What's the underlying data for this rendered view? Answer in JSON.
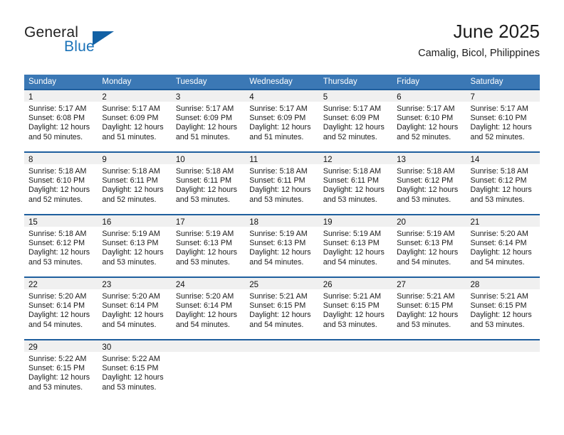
{
  "brand": {
    "name_top": "General",
    "name_bottom": "Blue",
    "triangle_color": "#1261a5",
    "blue_text_color": "#1a72b8"
  },
  "header": {
    "title": "June 2025",
    "subtitle": "Camalig, Bicol, Philippines"
  },
  "theme": {
    "header_bar_color": "#3b78b5",
    "row_border_color": "#1f5f9e",
    "day_band_color": "#f0f0f0"
  },
  "weekdays": [
    "Sunday",
    "Monday",
    "Tuesday",
    "Wednesday",
    "Thursday",
    "Friday",
    "Saturday"
  ],
  "weeks": [
    [
      {
        "day": "1",
        "sunrise": "Sunrise: 5:17 AM",
        "sunset": "Sunset: 6:08 PM",
        "daylight_1": "Daylight: 12 hours",
        "daylight_2": "and 50 minutes."
      },
      {
        "day": "2",
        "sunrise": "Sunrise: 5:17 AM",
        "sunset": "Sunset: 6:09 PM",
        "daylight_1": "Daylight: 12 hours",
        "daylight_2": "and 51 minutes."
      },
      {
        "day": "3",
        "sunrise": "Sunrise: 5:17 AM",
        "sunset": "Sunset: 6:09 PM",
        "daylight_1": "Daylight: 12 hours",
        "daylight_2": "and 51 minutes."
      },
      {
        "day": "4",
        "sunrise": "Sunrise: 5:17 AM",
        "sunset": "Sunset: 6:09 PM",
        "daylight_1": "Daylight: 12 hours",
        "daylight_2": "and 51 minutes."
      },
      {
        "day": "5",
        "sunrise": "Sunrise: 5:17 AM",
        "sunset": "Sunset: 6:09 PM",
        "daylight_1": "Daylight: 12 hours",
        "daylight_2": "and 52 minutes."
      },
      {
        "day": "6",
        "sunrise": "Sunrise: 5:17 AM",
        "sunset": "Sunset: 6:10 PM",
        "daylight_1": "Daylight: 12 hours",
        "daylight_2": "and 52 minutes."
      },
      {
        "day": "7",
        "sunrise": "Sunrise: 5:17 AM",
        "sunset": "Sunset: 6:10 PM",
        "daylight_1": "Daylight: 12 hours",
        "daylight_2": "and 52 minutes."
      }
    ],
    [
      {
        "day": "8",
        "sunrise": "Sunrise: 5:18 AM",
        "sunset": "Sunset: 6:10 PM",
        "daylight_1": "Daylight: 12 hours",
        "daylight_2": "and 52 minutes."
      },
      {
        "day": "9",
        "sunrise": "Sunrise: 5:18 AM",
        "sunset": "Sunset: 6:11 PM",
        "daylight_1": "Daylight: 12 hours",
        "daylight_2": "and 52 minutes."
      },
      {
        "day": "10",
        "sunrise": "Sunrise: 5:18 AM",
        "sunset": "Sunset: 6:11 PM",
        "daylight_1": "Daylight: 12 hours",
        "daylight_2": "and 53 minutes."
      },
      {
        "day": "11",
        "sunrise": "Sunrise: 5:18 AM",
        "sunset": "Sunset: 6:11 PM",
        "daylight_1": "Daylight: 12 hours",
        "daylight_2": "and 53 minutes."
      },
      {
        "day": "12",
        "sunrise": "Sunrise: 5:18 AM",
        "sunset": "Sunset: 6:11 PM",
        "daylight_1": "Daylight: 12 hours",
        "daylight_2": "and 53 minutes."
      },
      {
        "day": "13",
        "sunrise": "Sunrise: 5:18 AM",
        "sunset": "Sunset: 6:12 PM",
        "daylight_1": "Daylight: 12 hours",
        "daylight_2": "and 53 minutes."
      },
      {
        "day": "14",
        "sunrise": "Sunrise: 5:18 AM",
        "sunset": "Sunset: 6:12 PM",
        "daylight_1": "Daylight: 12 hours",
        "daylight_2": "and 53 minutes."
      }
    ],
    [
      {
        "day": "15",
        "sunrise": "Sunrise: 5:18 AM",
        "sunset": "Sunset: 6:12 PM",
        "daylight_1": "Daylight: 12 hours",
        "daylight_2": "and 53 minutes."
      },
      {
        "day": "16",
        "sunrise": "Sunrise: 5:19 AM",
        "sunset": "Sunset: 6:13 PM",
        "daylight_1": "Daylight: 12 hours",
        "daylight_2": "and 53 minutes."
      },
      {
        "day": "17",
        "sunrise": "Sunrise: 5:19 AM",
        "sunset": "Sunset: 6:13 PM",
        "daylight_1": "Daylight: 12 hours",
        "daylight_2": "and 53 minutes."
      },
      {
        "day": "18",
        "sunrise": "Sunrise: 5:19 AM",
        "sunset": "Sunset: 6:13 PM",
        "daylight_1": "Daylight: 12 hours",
        "daylight_2": "and 54 minutes."
      },
      {
        "day": "19",
        "sunrise": "Sunrise: 5:19 AM",
        "sunset": "Sunset: 6:13 PM",
        "daylight_1": "Daylight: 12 hours",
        "daylight_2": "and 54 minutes."
      },
      {
        "day": "20",
        "sunrise": "Sunrise: 5:19 AM",
        "sunset": "Sunset: 6:13 PM",
        "daylight_1": "Daylight: 12 hours",
        "daylight_2": "and 54 minutes."
      },
      {
        "day": "21",
        "sunrise": "Sunrise: 5:20 AM",
        "sunset": "Sunset: 6:14 PM",
        "daylight_1": "Daylight: 12 hours",
        "daylight_2": "and 54 minutes."
      }
    ],
    [
      {
        "day": "22",
        "sunrise": "Sunrise: 5:20 AM",
        "sunset": "Sunset: 6:14 PM",
        "daylight_1": "Daylight: 12 hours",
        "daylight_2": "and 54 minutes."
      },
      {
        "day": "23",
        "sunrise": "Sunrise: 5:20 AM",
        "sunset": "Sunset: 6:14 PM",
        "daylight_1": "Daylight: 12 hours",
        "daylight_2": "and 54 minutes."
      },
      {
        "day": "24",
        "sunrise": "Sunrise: 5:20 AM",
        "sunset": "Sunset: 6:14 PM",
        "daylight_1": "Daylight: 12 hours",
        "daylight_2": "and 54 minutes."
      },
      {
        "day": "25",
        "sunrise": "Sunrise: 5:21 AM",
        "sunset": "Sunset: 6:15 PM",
        "daylight_1": "Daylight: 12 hours",
        "daylight_2": "and 54 minutes."
      },
      {
        "day": "26",
        "sunrise": "Sunrise: 5:21 AM",
        "sunset": "Sunset: 6:15 PM",
        "daylight_1": "Daylight: 12 hours",
        "daylight_2": "and 53 minutes."
      },
      {
        "day": "27",
        "sunrise": "Sunrise: 5:21 AM",
        "sunset": "Sunset: 6:15 PM",
        "daylight_1": "Daylight: 12 hours",
        "daylight_2": "and 53 minutes."
      },
      {
        "day": "28",
        "sunrise": "Sunrise: 5:21 AM",
        "sunset": "Sunset: 6:15 PM",
        "daylight_1": "Daylight: 12 hours",
        "daylight_2": "and 53 minutes."
      }
    ],
    [
      {
        "day": "29",
        "sunrise": "Sunrise: 5:22 AM",
        "sunset": "Sunset: 6:15 PM",
        "daylight_1": "Daylight: 12 hours",
        "daylight_2": "and 53 minutes."
      },
      {
        "day": "30",
        "sunrise": "Sunrise: 5:22 AM",
        "sunset": "Sunset: 6:15 PM",
        "daylight_1": "Daylight: 12 hours",
        "daylight_2": "and 53 minutes."
      },
      {
        "day": "",
        "sunrise": "",
        "sunset": "",
        "daylight_1": "",
        "daylight_2": ""
      },
      {
        "day": "",
        "sunrise": "",
        "sunset": "",
        "daylight_1": "",
        "daylight_2": ""
      },
      {
        "day": "",
        "sunrise": "",
        "sunset": "",
        "daylight_1": "",
        "daylight_2": ""
      },
      {
        "day": "",
        "sunrise": "",
        "sunset": "",
        "daylight_1": "",
        "daylight_2": ""
      },
      {
        "day": "",
        "sunrise": "",
        "sunset": "",
        "daylight_1": "",
        "daylight_2": ""
      }
    ]
  ]
}
